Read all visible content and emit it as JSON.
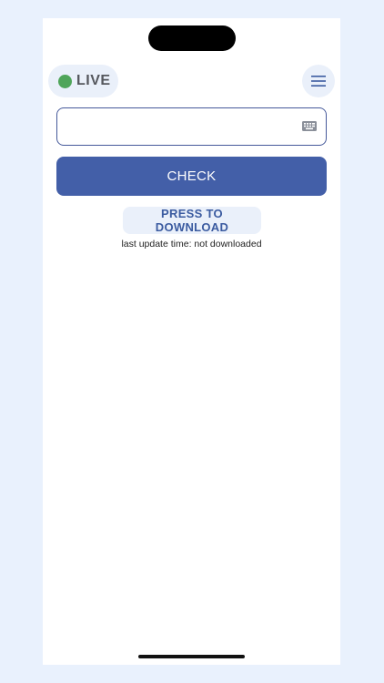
{
  "status": {
    "label": "LIVE",
    "dot_color": "#4fa55a"
  },
  "menu": {
    "icon": "hamburger-menu-icon"
  },
  "input": {
    "value": "",
    "placeholder": "",
    "icon": "keyboard-icon"
  },
  "actions": {
    "check_label": "CHECK",
    "download_label": "PRESS TO DOWNLOAD"
  },
  "update": {
    "text": "last update time: not downloaded"
  },
  "colors": {
    "primary": "#435fa8",
    "pill_background": "#eaf0fa",
    "page_background": "#e9f1fd"
  }
}
